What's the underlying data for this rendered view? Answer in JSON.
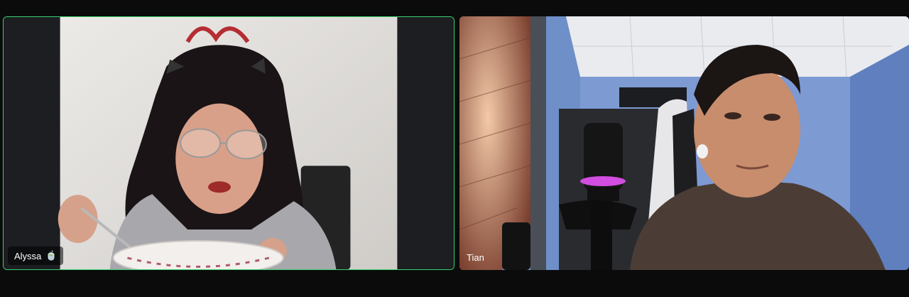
{
  "participants": [
    {
      "name": "Alyssa",
      "badge": "🍵",
      "active_speaker": true
    },
    {
      "name": "Tian",
      "badge": "",
      "active_speaker": false
    }
  ]
}
